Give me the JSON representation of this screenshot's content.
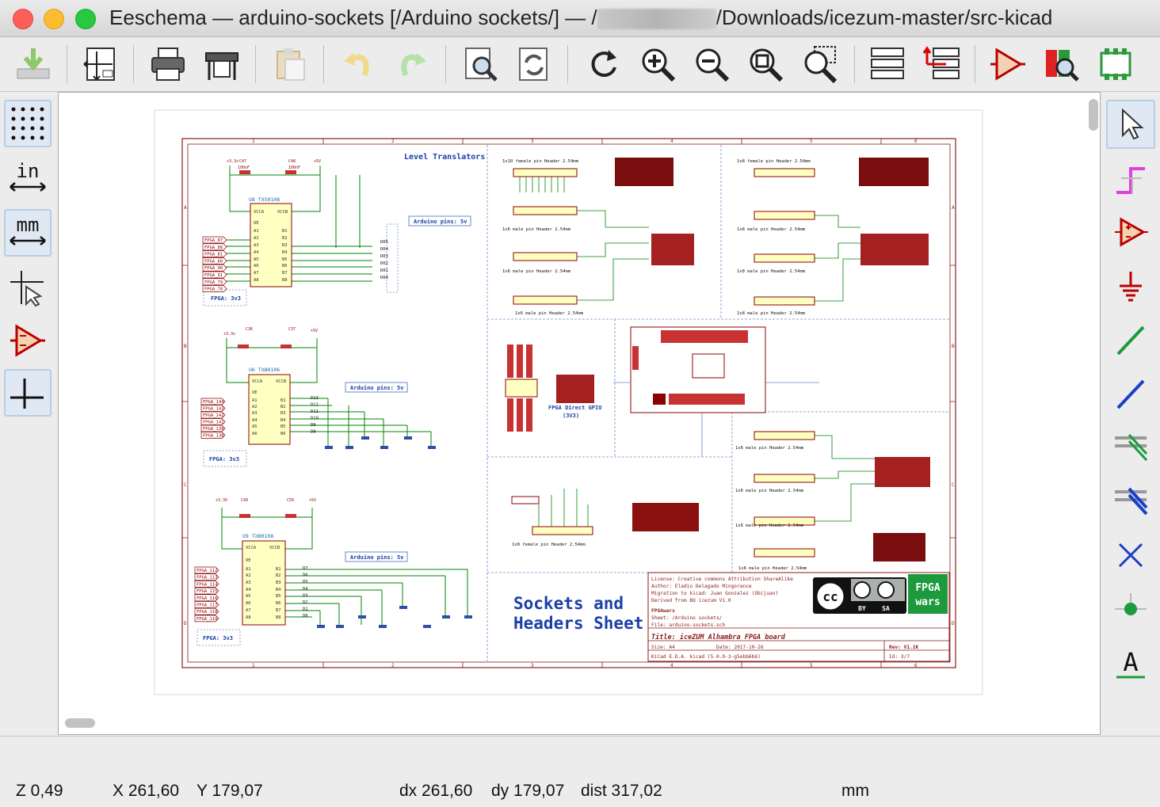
{
  "window": {
    "title_prefix": "Eeschema — arduino-sockets [/Arduino sockets/] — /",
    "title_suffix": "/Downloads/icezum-master/src-kicad"
  },
  "toolbar": {
    "buttons": [
      "save-icon",
      "page-settings-icon",
      "print-icon",
      "plot-icon",
      "paste-icon",
      "undo-icon",
      "redo-icon",
      "find-icon",
      "find-replace-icon",
      "redraw-icon",
      "zoom-in-icon",
      "zoom-out-icon",
      "zoom-fit-icon",
      "zoom-selection-icon",
      "hierarchy-navigator-icon",
      "leave-sheet-icon",
      "symbol-editor-icon",
      "symbol-browser-icon",
      "footprint-assign-icon"
    ]
  },
  "left_tools": [
    "grid-toggle-icon",
    "units-inch-icon",
    "units-mm-icon",
    "cursor-shape-icon",
    "hidden-pins-icon",
    "wire-angle-icon"
  ],
  "left_tool_labels": {
    "inch": "in",
    "mm": "mm"
  },
  "right_tools": [
    "select-arrow-icon",
    "highlight-net-icon",
    "add-symbol-icon",
    "add-power-icon",
    "add-wire-icon",
    "add-bus-icon",
    "wire-bus-entry-icon",
    "bus-bus-entry-icon",
    "no-connect-icon",
    "junction-icon",
    "net-label-icon"
  ],
  "right_tool_labels": {
    "net_label": "A"
  },
  "schematic": {
    "heading_level_translators": "Level Translators",
    "sheet_title_line1": "Sockets and",
    "sheet_title_line2": "Headers Sheet",
    "arduino_pins_label": "Arduino pins: 5v",
    "fpga_3v3_label": "FPGA: 3v3",
    "fpga_direct_gpio_1": "FPGA Direct GPIO",
    "fpga_direct_gpio_2": "(3V3)",
    "chip_u8": "U8  TXS0108",
    "chip_u6": "U6  TXB0106",
    "chip_u9": "U9  TXB0108",
    "header_1x10": "1x10 female pin Header 2.54mm",
    "header_1x8_female": "1x8 female pin Header 2.54mm",
    "header_1x6_male": "1x6 male pin Header 2.54mm",
    "header_1x8_male": "1x8 male pin Header 2.54mm",
    "u8_pins_left": [
      "FPGA_87",
      "FPGA_88",
      "FPGA_81",
      "FPGA_80",
      "FPGA_90",
      "FPGA_91",
      "FPGA_79",
      "FPGA_78"
    ],
    "u6_pins_left": [
      "FPGA_144",
      "FPGA_143",
      "FPGA_142",
      "FPGA_141",
      "FPGA_139",
      "FPGA_138"
    ],
    "u9_pins_left": [
      "FPGA_112",
      "FPGA_113",
      "FPGA_114",
      "FPGA_115",
      "FPGA_116",
      "FPGA_117",
      "FPGA_118",
      "FPGA_119"
    ],
    "u8_pins_right": [
      "D05",
      "D04",
      "D03",
      "D02",
      "D01",
      "D00"
    ],
    "u6_pins_right": [
      "D13",
      "D12",
      "D11",
      "D10",
      "D9",
      "D8"
    ],
    "u9_pins_right": [
      "D7",
      "D6",
      "D5",
      "D4",
      "D3",
      "D2",
      "D1",
      "D0"
    ],
    "title_block": {
      "license": "License: Creative commons Attribution ShareAlike",
      "author": "Author:  Eladio Delagado Mingorance",
      "migration": "Migration to kicad:  Juan Gonzalez (Obijuan)",
      "derived": "Derived from BQ icezum V1.0",
      "org": "FPGAwars",
      "sheet": "Sheet: /Arduino sockets/",
      "file": "File: arduino-sockets.sch",
      "title": "Title: iceZUM Alhambra FPGA board",
      "size": "Size: A4",
      "date": "Date: 2017-10-26",
      "rev": "Rev: V1.1K",
      "tool": "KiCad E.D.A.  kicad (5.0.0-3-g5ebb6b6)",
      "id": "Id: 3/7",
      "logo_text_1": "FPGA",
      "logo_text_2": "wars",
      "cc_by": "BY",
      "cc_sa": "SA"
    },
    "colors": {
      "sheet_border": "#8b1a1a",
      "wire": "#008400",
      "component": "#8b0000",
      "label_blue": "#1a3fa8",
      "logo_green": "#1c9a3c"
    }
  },
  "status": {
    "zoom": "Z 0,49",
    "x": "X 261,60",
    "y": "Y 179,07",
    "dx": "dx 261,60",
    "dy": "dy 179,07",
    "dist": "dist 317,02",
    "units": "mm"
  }
}
